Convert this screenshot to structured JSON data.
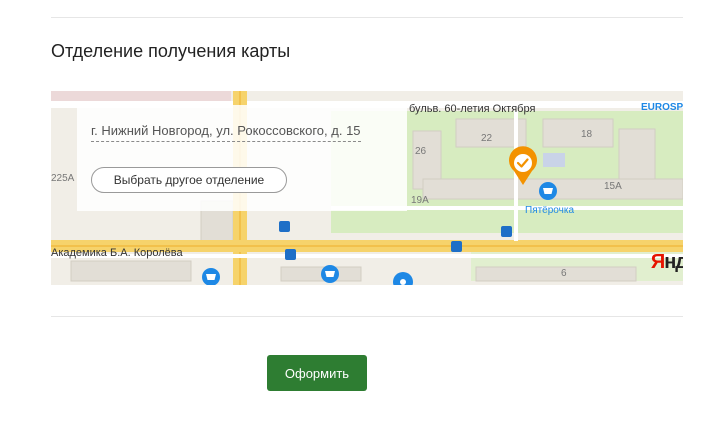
{
  "section": {
    "title": "Отделение получения карты"
  },
  "map": {
    "address": "г. Нижний Новгород, ул. Рокоссовского, д. 15",
    "choose_button_label": "Выбрать другое отделение",
    "street_labels": {
      "boulevard": "бульв. 60-летия Октября",
      "academician": "Академика Б.А. Королёва"
    },
    "house_numbers": {
      "n22": "22",
      "n18": "18",
      "n26": "26",
      "n225a": "225А",
      "n15a": "15А",
      "n19a": "19А",
      "n6": "6"
    },
    "poi": {
      "shop": "Пятёрочка",
      "brand": "EUROSP"
    },
    "logo": {
      "first_letter": "Я",
      "rest": "нд"
    },
    "colors": {
      "marker": "#f39200",
      "park": "#d7ecc0",
      "road_yellow": "#f6d36b",
      "poi_blue": "#1e88e5"
    },
    "icons": [
      "location-marker-icon",
      "shop-basket-icon",
      "bus-stop-icon",
      "flower-icon"
    ]
  },
  "actions": {
    "submit_label": "Оформить",
    "submit_color": "#2e7d32"
  }
}
